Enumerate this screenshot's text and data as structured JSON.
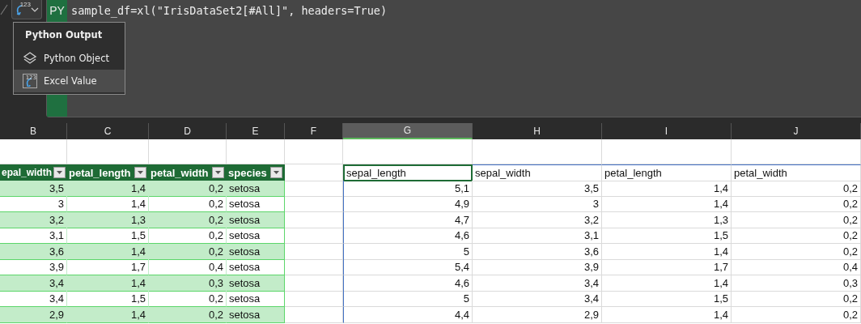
{
  "formula_bar": {
    "output_button": {
      "badge": "123"
    },
    "py_badge": "PY",
    "formula": "sample_df=xl(\"IrisDataSet2[#All]\", headers=True)"
  },
  "output_menu": {
    "title": "Python Output",
    "items": [
      {
        "kind": "layers",
        "label": "Python Object",
        "selected": false
      },
      {
        "kind": "value",
        "label": "Excel Value",
        "badge": "123",
        "selected": true
      }
    ]
  },
  "column_headers": [
    {
      "label": "B",
      "selected": false
    },
    {
      "label": "C",
      "selected": false
    },
    {
      "label": "D",
      "selected": false
    },
    {
      "label": "E",
      "selected": false
    },
    {
      "label": "F",
      "selected": false
    },
    {
      "label": "G",
      "selected": true
    },
    {
      "label": "H",
      "selected": false
    },
    {
      "label": "I",
      "selected": false
    },
    {
      "label": "J",
      "selected": false
    }
  ],
  "table": {
    "columns": [
      "epal_width",
      "petal_length",
      "petal_width",
      "species"
    ],
    "rows": [
      [
        "3,5",
        "1,4",
        "0,2",
        "setosa"
      ],
      [
        "3",
        "1,4",
        "0,2",
        "setosa"
      ],
      [
        "3,2",
        "1,3",
        "0,2",
        "setosa"
      ],
      [
        "3,1",
        "1,5",
        "0,2",
        "setosa"
      ],
      [
        "3,6",
        "1,4",
        "0,2",
        "setosa"
      ],
      [
        "3,9",
        "1,7",
        "0,4",
        "setosa"
      ],
      [
        "3,4",
        "1,4",
        "0,3",
        "setosa"
      ],
      [
        "3,4",
        "1,5",
        "0,2",
        "setosa"
      ],
      [
        "2,9",
        "1,4",
        "0,2",
        "setosa"
      ]
    ]
  },
  "spill": {
    "columns": [
      {
        "label": "sepal_length",
        "selected": true
      },
      {
        "label": "sepal_width",
        "selected": false
      },
      {
        "label": "petal_length",
        "selected": false
      },
      {
        "label": "petal_width",
        "selected": false
      }
    ],
    "rows": [
      [
        "5,1",
        "3,5",
        "1,4",
        "0,2"
      ],
      [
        "4,9",
        "3",
        "1,4",
        "0,2"
      ],
      [
        "4,7",
        "3,2",
        "1,3",
        "0,2"
      ],
      [
        "4,6",
        "3,1",
        "1,5",
        "0,2"
      ],
      [
        "5",
        "3,6",
        "1,4",
        "0,2"
      ],
      [
        "5,4",
        "3,9",
        "1,7",
        "0,4"
      ],
      [
        "4,6",
        "3,4",
        "1,4",
        "0,3"
      ],
      [
        "5",
        "3,4",
        "1,5",
        "0,2"
      ],
      [
        "4,4",
        "2,9",
        "1,4",
        "0,2"
      ]
    ]
  }
}
